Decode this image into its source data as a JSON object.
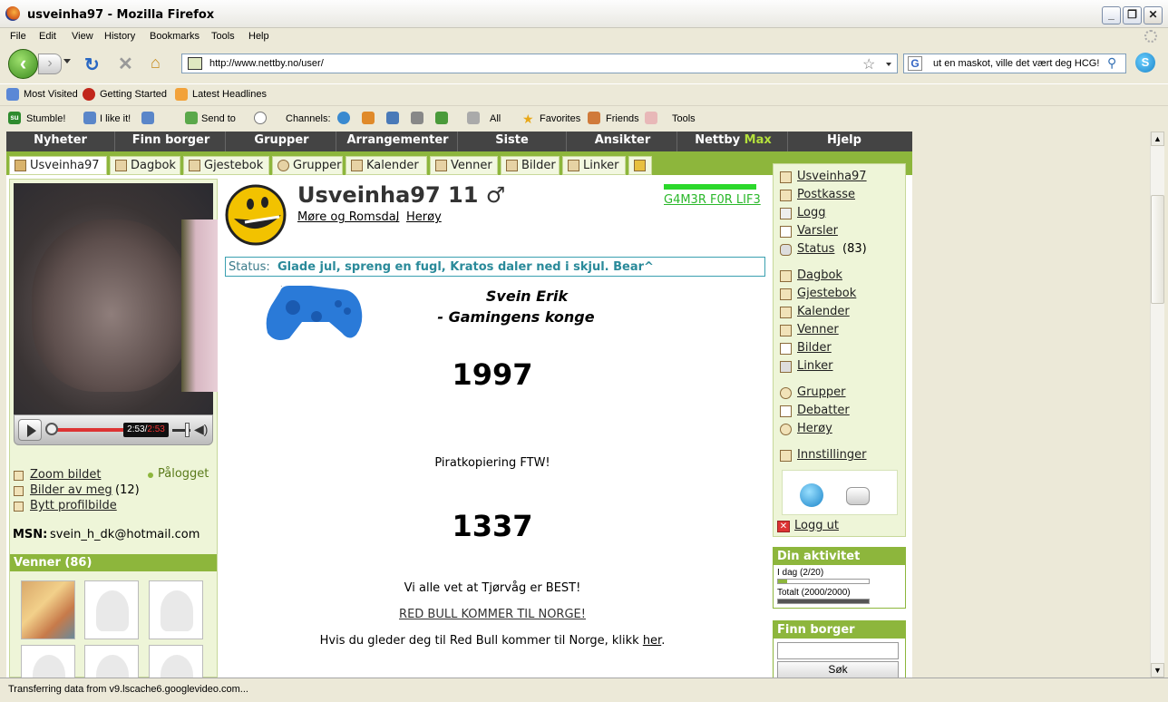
{
  "window": {
    "title": "usveinha97 - Mozilla Firefox"
  },
  "menu": [
    "File",
    "Edit",
    "View",
    "History",
    "Bookmarks",
    "Tools",
    "Help"
  ],
  "address": {
    "url": "http://www.nettby.no/user/"
  },
  "search": {
    "value": "ut en maskot, ville det vært deg HCG!"
  },
  "bookmarks": [
    "Most Visited",
    "Getting Started",
    "Latest Headlines"
  ],
  "stumble_toolbar": {
    "stumble": "Stumble!",
    "like": "I like it!",
    "send": "Send to",
    "channels": "Channels:",
    "all": "All",
    "favorites": "Favorites",
    "friends": "Friends",
    "tools": "Tools"
  },
  "site_nav": [
    "Nyheter",
    "Finn borger",
    "Grupper",
    "Arrangementer",
    "Siste",
    "Ansikter",
    "Nettby",
    "Hjelp"
  ],
  "site_nav_max": "Max",
  "sub_tabs": [
    "Usveinha97",
    "Dagbok",
    "Gjestebok",
    "Grupper",
    "Kalender",
    "Venner",
    "Bilder",
    "Linker"
  ],
  "player": {
    "time_current": "2:53",
    "time_total": "2:53"
  },
  "left": {
    "zoom": "Zoom bildet",
    "online": "Pålogget",
    "pictures_of_me": "Bilder av meg",
    "pictures_count": "(12)",
    "change_picture": "Bytt profilbilde",
    "msn_label": "MSN:",
    "msn_value": "svein_h_dk@hotmail.com",
    "friends_header": "Venner (86)"
  },
  "profile": {
    "name": "Usveinha97 11 ♂",
    "region": "Møre og Romsdal",
    "place": "Herøy",
    "badge": "G4M3R F0R LIF3",
    "status_label": "Status:",
    "status_text": "Glade jul, spreng en fugl, Kratos daler ned i skjul. Bear^",
    "line1": "Svein Erik",
    "line2": "- Gamingens konge",
    "year": "1997",
    "piracy": "Piratkopiering FTW!",
    "leet": "1337",
    "best": "Vi alle vet at Tjørvåg er BEST!",
    "redbull": "RED BULL KOMMER TIL NORGE!",
    "glad": "Hvis du gleder deg til Red Bull kommer til Norge, klikk",
    "here": "her",
    "dot": "."
  },
  "right": {
    "links": [
      "Usveinha97",
      "Postkasse",
      "Logg",
      "Varsler",
      "Status"
    ],
    "status_count": "(83)",
    "links2": [
      "Dagbok",
      "Gjestebok",
      "Kalender",
      "Venner",
      "Bilder",
      "Linker"
    ],
    "links3": [
      "Grupper",
      "Debatter",
      "Herøy"
    ],
    "settings": "Innstillinger",
    "logout": "Logg ut"
  },
  "activity": {
    "header": "Din aktivitet",
    "today": "I dag (2/20)",
    "today_progress": 0.1,
    "total": "Totalt (2000/2000)",
    "total_progress": 1.0
  },
  "finn": {
    "header": "Finn borger",
    "button": "Søk"
  },
  "statusbar": "Transferring data from v9.lscache6.googlevideo.com..."
}
